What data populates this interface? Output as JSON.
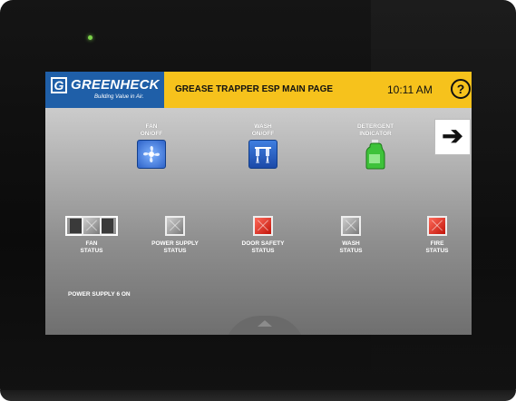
{
  "header": {
    "brand": "GREENHECK",
    "brand_tagline": "Building Value in Air.",
    "page_title": "GREASE TRAPPER ESP MAIN PAGE",
    "time": "10:11 AM",
    "help_label": "?",
    "brand_color": "#1f5fa8",
    "bar_color": "#f6c21c"
  },
  "controls": {
    "fan": {
      "label_line1": "FAN",
      "label_line2": "ON/OFF",
      "icon": "fan-icon"
    },
    "wash": {
      "label_line1": "WASH",
      "label_line2": "ON/OFF",
      "icon": "spray-nozzle-icon"
    },
    "detergent": {
      "label_line1": "DETERGENT",
      "label_line2": "INDICATOR",
      "icon": "detergent-bottle-icon"
    },
    "next": {
      "glyph": "➔",
      "icon": "arrow-right-icon"
    }
  },
  "statuses": [
    {
      "line1": "FAN",
      "line2": "STATUS",
      "state": "grey"
    },
    {
      "line1": "POWER SUPPLY",
      "line2": "STATUS",
      "state": "grey"
    },
    {
      "line1": "DOOR SAFETY",
      "line2": "STATUS",
      "state": "red"
    },
    {
      "line1": "WASH",
      "line2": "STATUS",
      "state": "grey"
    },
    {
      "line1": "FIRE",
      "line2": "STATUS",
      "state": "red"
    }
  ],
  "message": "POWER SUPPLY 6 ON",
  "colors": {
    "status_red": "#d8261a",
    "status_grey": "#9a9a9a"
  }
}
